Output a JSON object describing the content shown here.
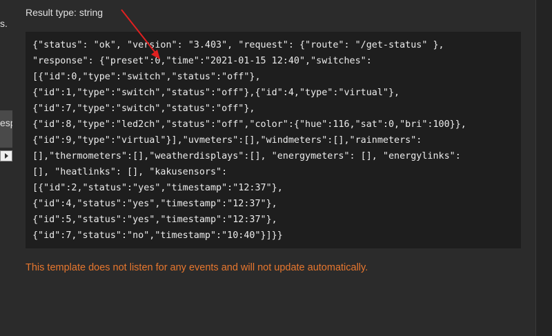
{
  "left_panel": {
    "fragment_top": "s.",
    "fragment_mid": "esp"
  },
  "result_type_label": "Result type: string",
  "code_lines": [
    "{\"status\": \"ok\", \"version\": \"3.403\", \"request\": {\"route\": \"/get-status\" },",
    "\"response\": {\"preset\":0,\"time\":\"2021-01-15 12:40\",\"switches\":",
    "[{\"id\":0,\"type\":\"switch\",\"status\":\"off\"},",
    "{\"id\":1,\"type\":\"switch\",\"status\":\"off\"},{\"id\":4,\"type\":\"virtual\"},",
    "{\"id\":7,\"type\":\"switch\",\"status\":\"off\"},",
    "{\"id\":8,\"type\":\"led2ch\",\"status\":\"off\",\"color\":{\"hue\":116,\"sat\":0,\"bri\":100}},",
    "{\"id\":9,\"type\":\"virtual\"}],\"uvmeters\":[],\"windmeters\":[],\"rainmeters\":",
    "[],\"thermometers\":[],\"weatherdisplays\":[], \"energymeters\": [], \"energylinks\":",
    "[], \"heatlinks\": [], \"kakusensors\":",
    "[{\"id\":2,\"status\":\"yes\",\"timestamp\":\"12:37\"},",
    "{\"id\":4,\"status\":\"yes\",\"timestamp\":\"12:37\"},",
    "{\"id\":5,\"status\":\"yes\",\"timestamp\":\"12:37\"},",
    "{\"id\":7,\"status\":\"no\",\"timestamp\":\"10:40\"}]}}"
  ],
  "notice": "This template does not listen for any events and will not update automatically.",
  "colors": {
    "background": "#2b2b2b",
    "code_background": "#1e1e1e",
    "notice": "#e8772e",
    "annotation_arrow": "#e02020"
  }
}
